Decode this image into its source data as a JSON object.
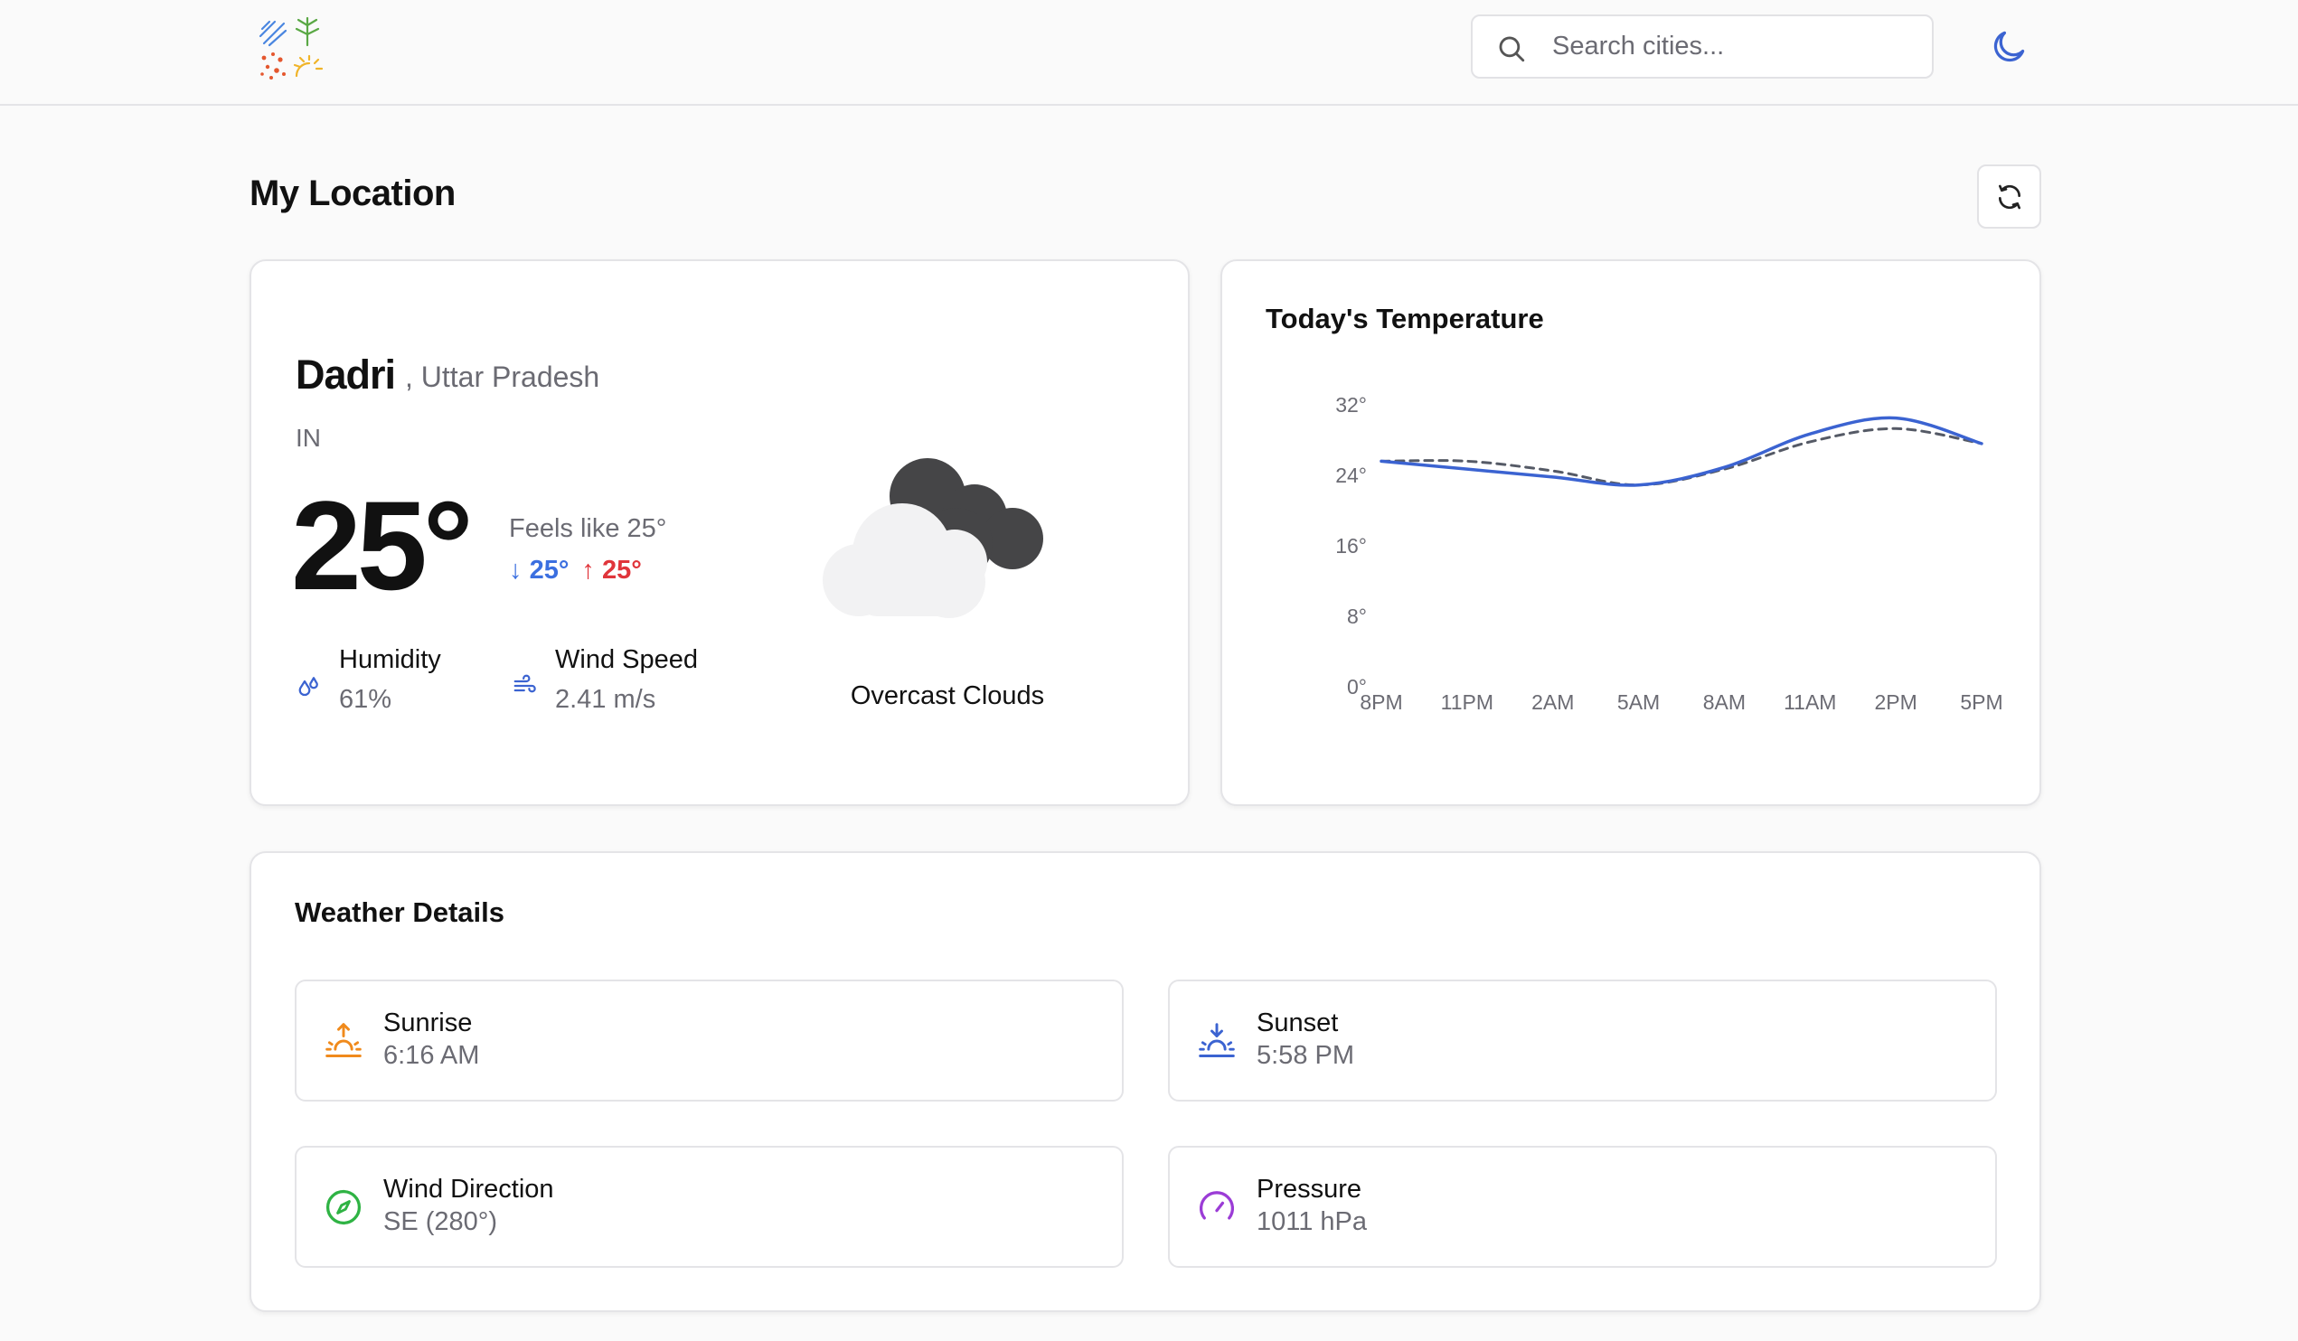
{
  "header": {
    "search_placeholder": "Search cities..."
  },
  "page": {
    "title": "My Location"
  },
  "current": {
    "city": "Dadri",
    "region": ", Uttar Pradesh",
    "country": "IN",
    "temperature": "25°",
    "feels_like": "Feels like 25°",
    "temp_min": "25°",
    "temp_max": "25°",
    "humidity_label": "Humidity",
    "humidity_value": "61%",
    "wind_label": "Wind Speed",
    "wind_value": "2.41 m/s",
    "condition": "Overcast Clouds"
  },
  "chart_data": {
    "type": "line",
    "title": "Today's Temperature",
    "categories": [
      "8PM",
      "11PM",
      "2AM",
      "5AM",
      "8AM",
      "11AM",
      "2PM",
      "5PM"
    ],
    "x": [
      0,
      1,
      2,
      3,
      4,
      5,
      6,
      7
    ],
    "series": [
      {
        "style": "solid",
        "color": "#3b63d1",
        "values": [
          25.5,
          24.6,
          23.7,
          22.8,
          24.8,
          28.6,
          30.4,
          27.5
        ]
      },
      {
        "style": "dashed",
        "color": "#555a66",
        "values": [
          25.5,
          25.5,
          24.4,
          22.8,
          24.6,
          27.7,
          29.2,
          27.5
        ]
      }
    ],
    "yticks": [
      "0°",
      "8°",
      "16°",
      "24°",
      "32°"
    ],
    "ytick_values": [
      0,
      8,
      16,
      24,
      32
    ],
    "ylim": [
      0,
      32
    ],
    "grid": false
  },
  "details": {
    "title": "Weather Details",
    "items": [
      {
        "label": "Sunrise",
        "value": "6:16 AM",
        "icon": "sunrise-icon",
        "color": "#f08a1c"
      },
      {
        "label": "Sunset",
        "value": "5:58 PM",
        "icon": "sunset-icon",
        "color": "#3b63d1"
      },
      {
        "label": "Wind Direction",
        "value": "SE (280°)",
        "icon": "compass-icon",
        "color": "#2fb344"
      },
      {
        "label": "Pressure",
        "value": "1011 hPa",
        "icon": "gauge-icon",
        "color": "#9b3cd6"
      }
    ]
  },
  "colors": {
    "accent": "#3b63d1",
    "min_temp": "#3b6fe0",
    "max_temp": "#e0353b"
  }
}
